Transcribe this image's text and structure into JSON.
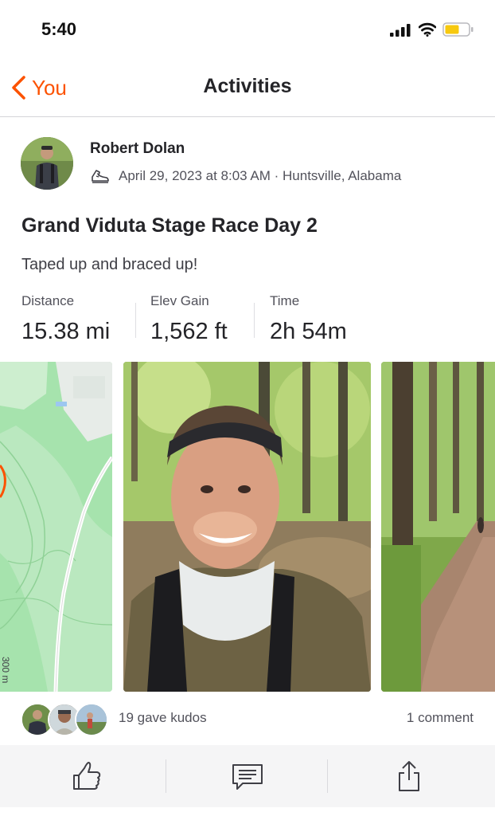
{
  "status_bar": {
    "time": "5:40"
  },
  "nav": {
    "back_label": "You",
    "title": "Activities"
  },
  "activity": {
    "athlete_name": "Robert Dolan",
    "activity_type_icon": "run-shoe-icon",
    "meta": "April 29, 2023 at 8:03 AM · Huntsville, Alabama",
    "title": "Grand Viduta Stage Race Day 2",
    "description": "Taped up and braced up!",
    "stats": [
      {
        "label": "Distance",
        "value": "15.38 mi"
      },
      {
        "label": "Elev Gain",
        "value": "1,562 ft"
      },
      {
        "label": "Time",
        "value": "2h 54m"
      }
    ],
    "map_label": "300 m"
  },
  "social": {
    "kudos_text": "19 gave kudos",
    "comments_text": "1 comment"
  },
  "actions": {
    "kudos_icon": "thumbs-up-icon",
    "comment_icon": "comment-icon",
    "share_icon": "share-icon"
  },
  "colors": {
    "brand": "#fc5200",
    "map_green": "#9ee0a6",
    "map_light": "#e8eeea"
  }
}
